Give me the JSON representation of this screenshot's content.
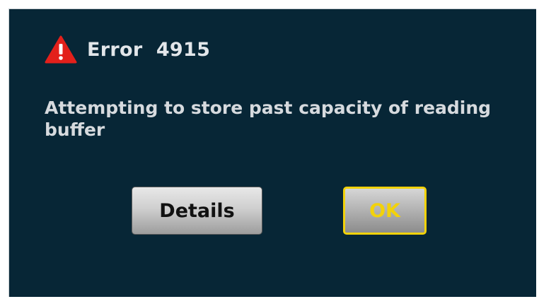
{
  "dialog": {
    "title": "Error  4915",
    "icon": "warning-triangle-icon",
    "message": "Attempting to store past capacity of reading buffer",
    "buttons": {
      "details_label": "Details",
      "ok_label": "OK"
    },
    "colors": {
      "background": "#072636",
      "text": "#d6dade",
      "icon": "#e3201b",
      "ok_accent": "#f2d20a"
    }
  }
}
